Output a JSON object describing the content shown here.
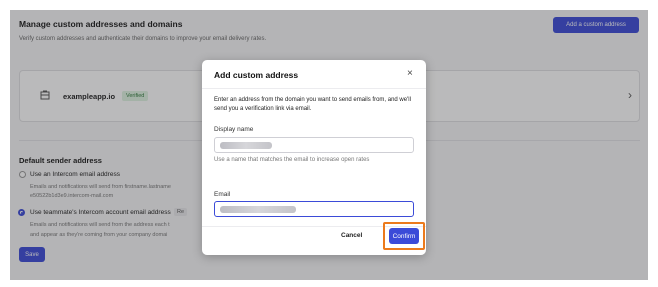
{
  "page": {
    "title": "Manage custom addresses and domains",
    "subtitle": "Verify custom addresses and authenticate their domains to improve your email delivery rates.",
    "add_button": "Add a custom address"
  },
  "domain_card": {
    "domain": "exampleapp.io",
    "status": "Verified",
    "icon": "building-icon",
    "chevron": "›"
  },
  "sender": {
    "title": "Default sender address",
    "options": [
      {
        "label": "Use an Intercom email address",
        "desc_lines": [
          "Emails and notifications will send from firstname.lastname",
          "e50522b1d3e9.intercom-mail.com"
        ],
        "selected": false
      },
      {
        "label": "Use teammate's Intercom account email address",
        "tag": "Re",
        "desc_lines": [
          "Emails and notifications will send from the address each t",
          "and appear as they're coming from your company domai"
        ],
        "selected": true
      }
    ],
    "save_label": "Save"
  },
  "modal": {
    "title": "Add custom address",
    "close": "×",
    "description": "Enter an address from the domain you want to send emails from, and we'll send you a verification link via email.",
    "display_name_label": "Display name",
    "display_name_hint": "Use a name that matches the email to increase open rates",
    "email_label": "Email",
    "cancel_label": "Cancel",
    "confirm_label": "Confirm"
  },
  "colors": {
    "accent": "#3b4bd8",
    "highlight": "#ec7a1c",
    "verified_bg": "#dff3e2"
  }
}
